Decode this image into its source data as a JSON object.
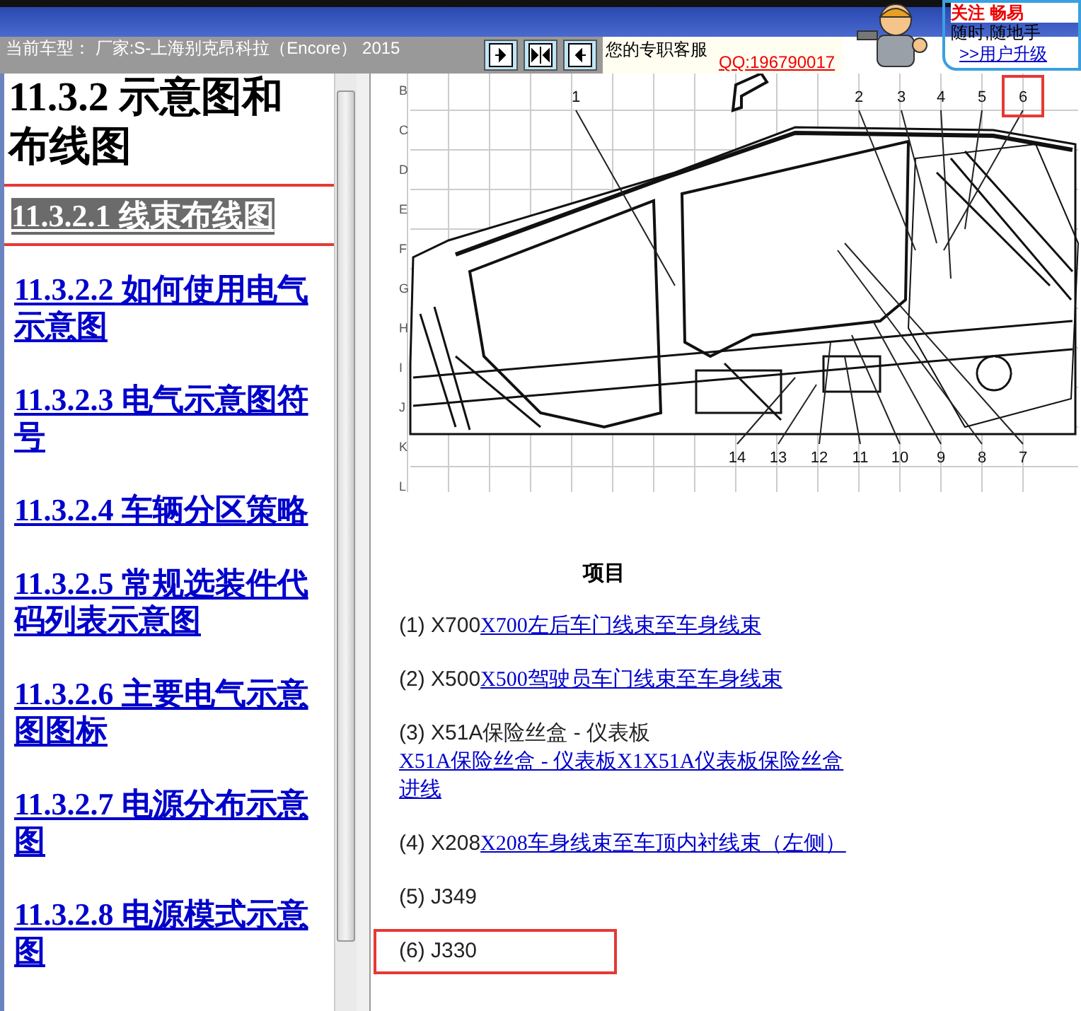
{
  "header": {
    "vehicle_text": "当前车型： 厂家:S-上海别克昂科拉（Encore） 2015",
    "nav_buttons": [
      {
        "kind": "right"
      },
      {
        "kind": "both"
      },
      {
        "kind": "left"
      }
    ],
    "service_label": "您的专职客服",
    "qq_link": "QQ:196790017",
    "promo": {
      "title": "关注 畅易",
      "line": "随时,随地手",
      "link": ">>用户升级"
    }
  },
  "sidebar": {
    "heading": "11.3.2 示意图和布线图",
    "items": [
      {
        "label": "11.3.2.1 线束布线图",
        "selected": true,
        "highlighted": true
      },
      {
        "label": "11.3.2.2 如何使用电气示意图",
        "selected": false,
        "highlighted": false
      },
      {
        "label": "11.3.2.3 电气示意图符号",
        "selected": false,
        "highlighted": false
      },
      {
        "label": "11.3.2.4 车辆分区策略",
        "selected": false,
        "highlighted": false
      },
      {
        "label": "11.3.2.5 常规选装件代码列表示意图",
        "selected": false,
        "highlighted": false
      },
      {
        "label": "11.3.2.6 主要电气示意图图标",
        "selected": false,
        "highlighted": false
      },
      {
        "label": "11.3.2.7 电源分布示意图",
        "selected": false,
        "highlighted": false
      },
      {
        "label": "11.3.2.8 电源模式示意图",
        "selected": false,
        "highlighted": false
      }
    ]
  },
  "diagram": {
    "row_labels": [
      "B",
      "C",
      "D",
      "E",
      "F",
      "G",
      "H",
      "I",
      "J",
      "K",
      "L"
    ],
    "callouts": [
      {
        "label": "1",
        "highlighted": false
      },
      {
        "label": "2",
        "highlighted": false
      },
      {
        "label": "3",
        "highlighted": false
      },
      {
        "label": "4",
        "highlighted": false
      },
      {
        "label": "5",
        "highlighted": false
      },
      {
        "label": "6",
        "highlighted": true
      },
      {
        "label": "14",
        "highlighted": false
      },
      {
        "label": "13",
        "highlighted": false
      },
      {
        "label": "12",
        "highlighted": false
      },
      {
        "label": "11",
        "highlighted": false
      },
      {
        "label": "10",
        "highlighted": false
      },
      {
        "label": "9",
        "highlighted": false
      },
      {
        "label": "8",
        "highlighted": false
      },
      {
        "label": "7",
        "highlighted": false
      }
    ]
  },
  "items_heading": "项目",
  "items": [
    {
      "text": "(1) X700",
      "link": "X700左后车门线束至车身线束",
      "highlighted": false
    },
    {
      "text": "(2) X500",
      "link": "X500驾驶员车门线束至车身线束",
      "highlighted": false
    },
    {
      "text": "(3) X51A保险丝盒 - 仪表板 ",
      "link": "X51A保险丝盒 - 仪表板X1X51A仪表板保险丝盒进线",
      "highlighted": false
    },
    {
      "text": "(4) X208",
      "link": "X208车身线束至车顶内衬线束（左侧）",
      "highlighted": false
    },
    {
      "text": "(5) J349",
      "highlighted": false
    },
    {
      "text": "(6) J330",
      "highlighted": true
    }
  ]
}
